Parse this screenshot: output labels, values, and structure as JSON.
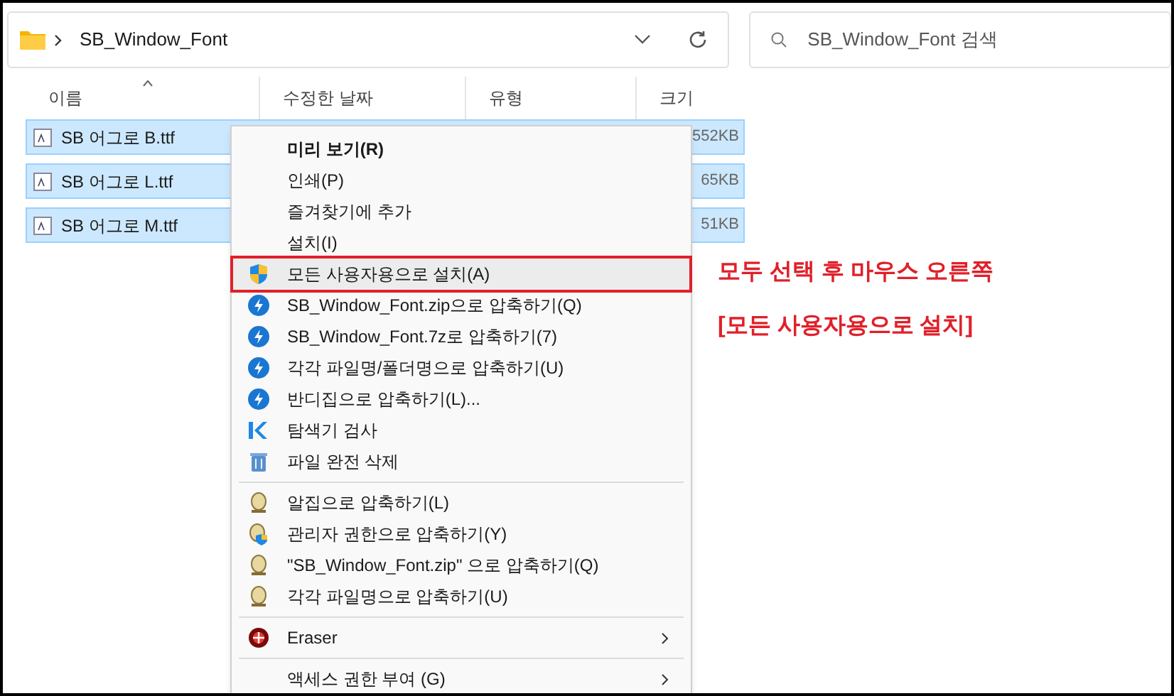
{
  "address_bar": {
    "path": "SB_Window_Font"
  },
  "search": {
    "placeholder": "SB_Window_Font 검색"
  },
  "columns": [
    {
      "label": "이름",
      "sorted": true
    },
    {
      "label": "수정한 날짜",
      "sorted": false
    },
    {
      "label": "유형",
      "sorted": false
    },
    {
      "label": "크기",
      "sorted": false
    }
  ],
  "files": [
    {
      "name": "SB 어그로 B.ttf",
      "size": "552KB",
      "selected": true
    },
    {
      "name": "SB 어그로 L.ttf",
      "size": "65KB",
      "selected": true
    },
    {
      "name": "SB 어그로 M.ttf",
      "size": "51KB",
      "selected": true
    }
  ],
  "context_menu": [
    {
      "kind": "plain",
      "label": "미리 보기(R)",
      "bold": true,
      "selected": false
    },
    {
      "kind": "plain",
      "label": "인쇄(P)",
      "bold": false,
      "selected": false
    },
    {
      "kind": "plain",
      "label": "즐겨찾기에 추가",
      "bold": false,
      "selected": false
    },
    {
      "kind": "plain",
      "label": "설치(I)",
      "bold": false,
      "selected": false
    },
    {
      "kind": "shield",
      "label": "모든 사용자용으로 설치(A)",
      "bold": false,
      "selected": true
    },
    {
      "kind": "bolt",
      "label": "SB_Window_Font.zip으로 압축하기(Q)",
      "bold": false,
      "selected": false
    },
    {
      "kind": "bolt",
      "label": "SB_Window_Font.7z로 압축하기(7)",
      "bold": false,
      "selected": false
    },
    {
      "kind": "bolt",
      "label": "각각 파일명/폴더명으로 압축하기(U)",
      "bold": false,
      "selected": false
    },
    {
      "kind": "bolt",
      "label": "반디집으로 압축하기(L)...",
      "bold": false,
      "selected": false
    },
    {
      "kind": "scan",
      "label": "탐색기 검사",
      "bold": false,
      "selected": false
    },
    {
      "kind": "trash",
      "label": "파일 완전 삭제",
      "bold": false,
      "selected": false
    },
    {
      "kind": "separator"
    },
    {
      "kind": "egg",
      "label": "알집으로 압축하기(L)",
      "bold": false,
      "selected": false
    },
    {
      "kind": "eggshield",
      "label": "관리자 권한으로 압축하기(Y)",
      "bold": false,
      "selected": false
    },
    {
      "kind": "egg",
      "label": "\"SB_Window_Font.zip\" 으로 압축하기(Q)",
      "bold": false,
      "selected": false
    },
    {
      "kind": "egg",
      "label": "각각 파일명으로 압축하기(U)",
      "bold": false,
      "selected": false
    },
    {
      "kind": "separator"
    },
    {
      "kind": "disc",
      "label": "Eraser",
      "bold": false,
      "selected": false,
      "submenu": true
    },
    {
      "kind": "separator"
    },
    {
      "kind": "plain",
      "label": "액세스 권한 부여 (G)",
      "bold": false,
      "selected": false,
      "submenu": true
    }
  ],
  "annotation": [
    "모두 선택 후 마우스 오른쪽",
    "[모든 사용자용으로 설치]"
  ]
}
